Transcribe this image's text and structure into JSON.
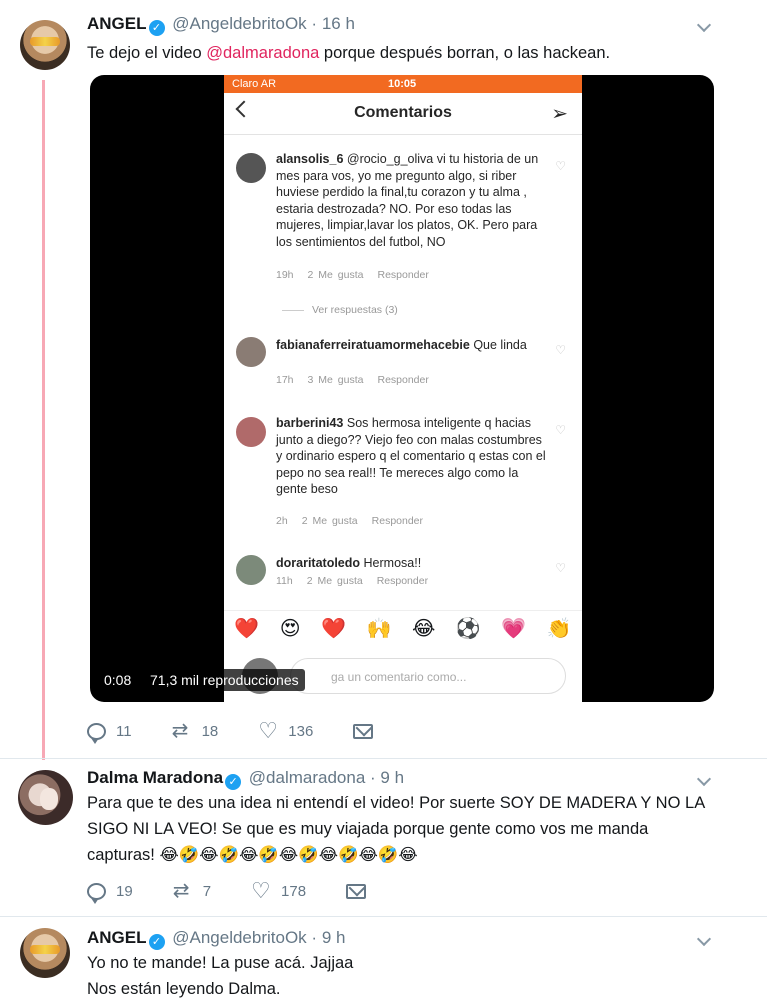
{
  "tweets": [
    {
      "name": "ANGEL",
      "handle": "@AngeldebritoOk",
      "time": "16 h",
      "text_before": "Te dejo el video ",
      "mention": "@dalmaradona",
      "text_after": " porque después borran, o las hackean.",
      "replies": "11",
      "retweets": "18",
      "likes": "136"
    },
    {
      "name": "Dalma Maradona",
      "handle": "@dalmaradona",
      "time": "9 h",
      "text": "Para que te des una idea ni entendí el video! Por suerte SOY DE MADERA Y NO LA SIGO NI LA VEO! Se que es muy viajada porque gente como vos me manda capturas! 😂🤣😂🤣😂🤣😂🤣😂🤣😂🤣😂",
      "replies": "19",
      "retweets": "7",
      "likes": "178"
    },
    {
      "name": "ANGEL",
      "handle": "@AngeldebritoOk",
      "time": "9 h",
      "line1": "Yo no te mande! La puse acá. Jajjaa",
      "line2": "Nos están leyendo Dalma."
    }
  ],
  "separator": "·",
  "verified_glyph": "✓",
  "video": {
    "elapsed": "0:08",
    "views": "71,3 mil reproducciones",
    "phone": {
      "carrier": "Claro AR",
      "clock": "10:05",
      "header_title": "Comentarios",
      "view_replies": "Ver respuestas (3)",
      "comment_placeholder": "ga un comentario como...",
      "emojis": [
        "❤️",
        "😍",
        "❤️",
        "🙌",
        "😂",
        "⚽",
        "💗",
        "👏"
      ],
      "comments": [
        {
          "user": "alansolis_6",
          "text": " @rocio_g_oliva vi tu historia de un mes para vos, yo me pregunto algo, si riber huviese perdido la final,tu corazon y tu alma , estaria destrozada? NO. Por eso todas las mujeres, limpiar,lavar los platos, OK. Pero para los sentimientos del futbol, NO",
          "age": "19h",
          "likes": "2 Me gusta",
          "reply": "Responder"
        },
        {
          "user": "fabianaferreiratuamormehacebie",
          "text": " Que linda",
          "age": "17h",
          "likes": "3 Me gusta",
          "reply": "Responder"
        },
        {
          "user": "barberini43",
          "text": " Sos hermosa inteligente q hacias junto a diego?? Viejo feo con malas costumbres y ordinario espero q el comentario q estas con el pepo no sea real!! Te mereces algo como la gente beso",
          "age": "2h",
          "likes": "2 Me gusta",
          "reply": "Responder"
        },
        {
          "user": "doraritatoledo",
          "text": " Hermosa!!",
          "age": "11h",
          "likes": "2 Me gusta",
          "reply": "Responder"
        }
      ]
    }
  },
  "colors": {
    "mention": "#e0245e",
    "verified": "#1da1f2",
    "thread_line": "#f7a8b5",
    "ig_status_bar": "#f26a21"
  },
  "icons": [
    "reply-icon",
    "retweet-icon",
    "heart-icon",
    "mail-icon",
    "verified-badge-icon",
    "chevron-down-icon"
  ]
}
